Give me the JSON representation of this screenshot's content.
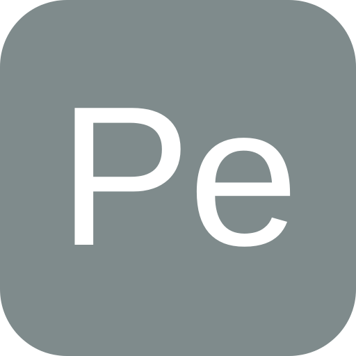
{
  "icon": {
    "label": "Pe",
    "background_color": "#7f8b8c",
    "text_color": "#ffffff"
  }
}
